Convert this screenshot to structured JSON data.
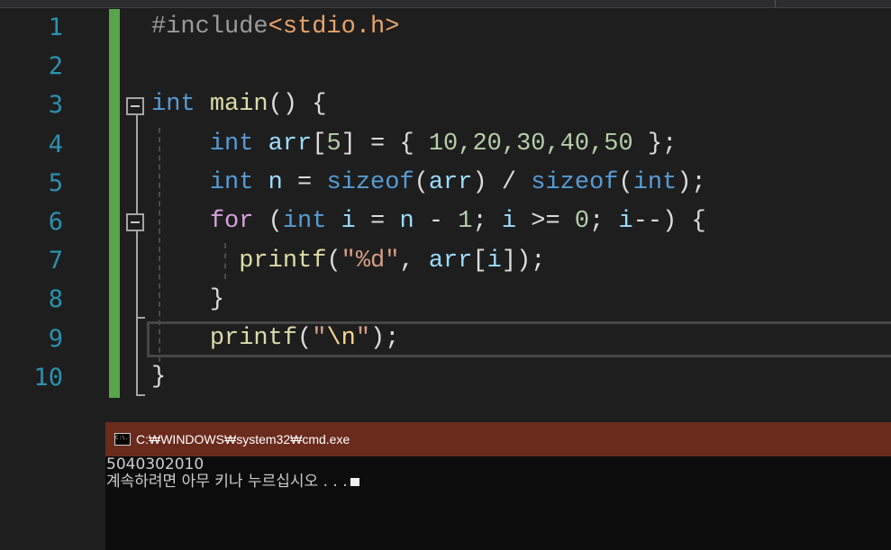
{
  "editor": {
    "line_numbers": [
      "1",
      "2",
      "3",
      "4",
      "5",
      "6",
      "7",
      "8",
      "9",
      "10"
    ],
    "line1": {
      "directive": "#include",
      "header": "<stdio.h>"
    },
    "line3": {
      "type": "int",
      "name": "main",
      "rest": "() {"
    },
    "line4": {
      "type": "int",
      "var": "arr",
      "b1": "[",
      "size": "5",
      "b2": "] = { ",
      "values": "10,20,30,40,50",
      "end": " };"
    },
    "line5": {
      "type": "int",
      "var": "n",
      "eq": " = ",
      "fn1": "sizeof",
      "p1": "(",
      "arg1": "arr",
      "p2": ") / ",
      "fn2": "sizeof",
      "p3": "(",
      "arg2": "int",
      "p4": ");"
    },
    "line6": {
      "kw": "for",
      "p1": " (",
      "type": "int",
      "i": "i",
      "eq": " = ",
      "n": "n",
      "minus": " - ",
      "one": "1",
      "semi1": "; ",
      "i2": "i",
      "ge": " >= ",
      "zero": "0",
      "semi2": "; ",
      "i3": "i",
      "rest": "--) {"
    },
    "line7": {
      "fn": "printf",
      "p1": "(",
      "str": "\"%d\"",
      "comma": ", ",
      "arr": "arr",
      "b1": "[",
      "i": "i",
      "b2": "]);"
    },
    "line8": {
      "brace": "}"
    },
    "line9": {
      "fn": "printf",
      "p1": "(",
      "q1": "\"",
      "esc": "\\n",
      "q2": "\"",
      "end": ");"
    },
    "line10": {
      "brace": "}"
    }
  },
  "console": {
    "title": "C:₩WINDOWS₩system32₩cmd.exe",
    "icon_text": "C:\\.",
    "output_line1": "5040302010",
    "output_line2": "계속하려면 아무 키나 누르십시오 . . ."
  },
  "colors": {
    "keyword": "#569cd6",
    "control": "#d8a0df",
    "function": "#dcdcaa",
    "variable": "#9cdcfe",
    "number": "#b5cea8",
    "string": "#d69d85",
    "line_number": "#2b91af",
    "change_bar": "#57a64a",
    "console_title_bar": "#6a2b1d"
  }
}
